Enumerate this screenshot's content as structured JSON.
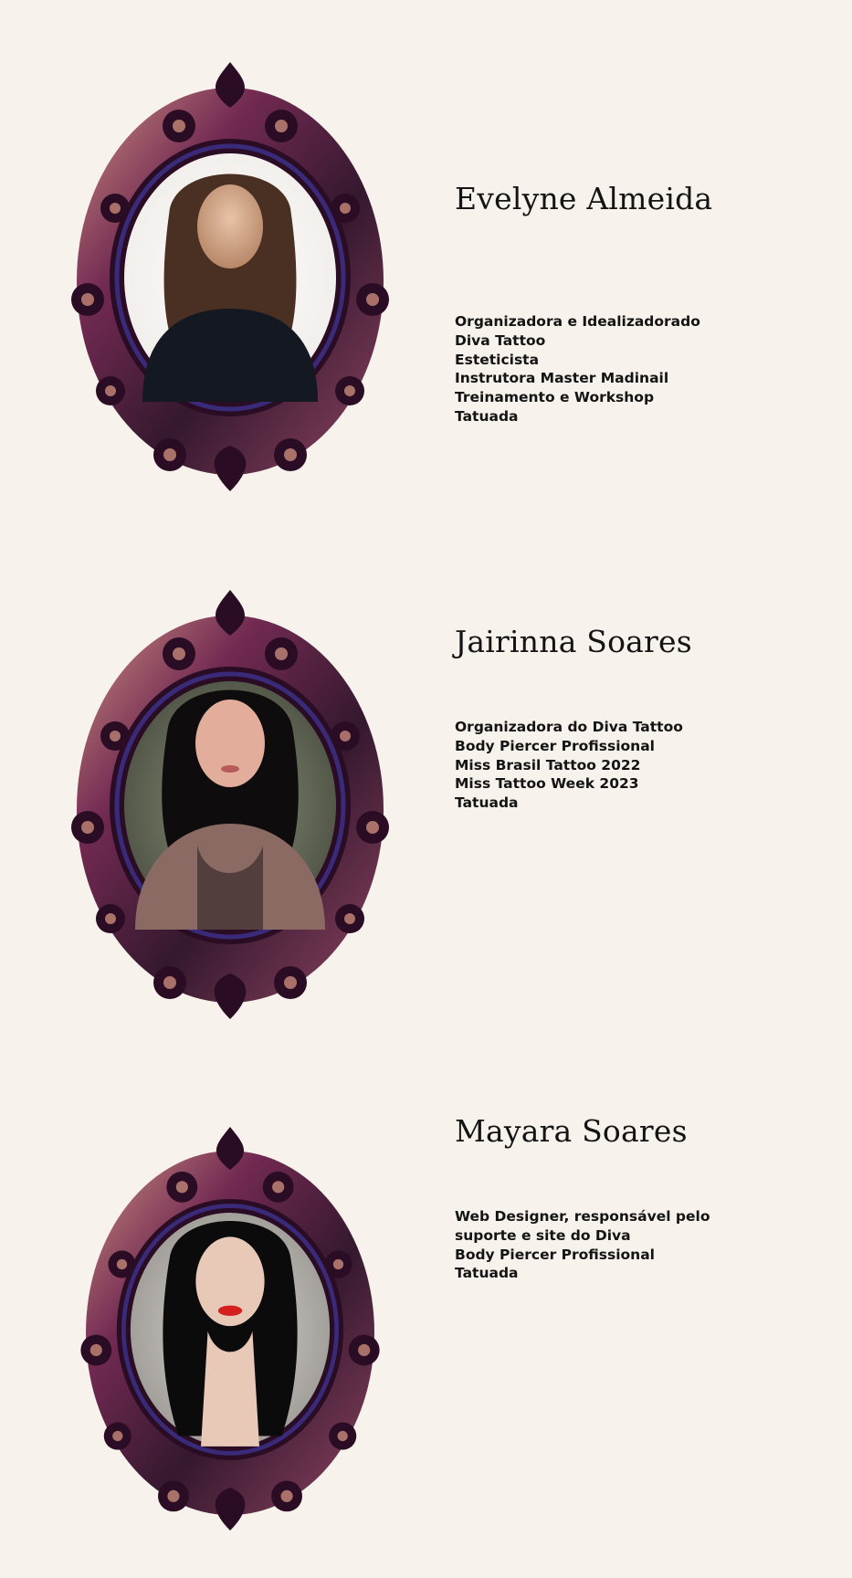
{
  "profiles": [
    {
      "name": "Evelyne Almeida",
      "description_lines": [
        "Organizadora e Idealizadorado Diva Tattoo",
        "Esteticista",
        "Instrutora Master Madinail",
        "Treinamento e Workshop",
        "Tatuada"
      ],
      "photo_icon": "portrait-photo-woman-brown-hair",
      "frame_icon": "ornate-baroque-oval-frame"
    },
    {
      "name": "Jairinna Soares",
      "description_lines": [
        "Organizadora do Diva Tattoo",
        "Body Piercer Profissional",
        "Miss Brasil Tattoo 2022",
        "Miss Tattoo Week 2023",
        "Tatuada"
      ],
      "photo_icon": "portrait-photo-woman-black-hair-tattoos",
      "frame_icon": "ornate-baroque-oval-frame"
    },
    {
      "name": "Mayara Soares",
      "description_lines": [
        "Web Designer, responsável pelo suporte e site do Diva",
        "Body Piercer Profissional",
        "Tatuada"
      ],
      "photo_icon": "portrait-photo-woman-black-hair-red-lips",
      "frame_icon": "ornate-baroque-oval-frame"
    }
  ],
  "colors": {
    "background": "#f7f2ec",
    "text": "#141414",
    "frame_dark": "#2a0d24",
    "frame_mid": "#6b1f4a",
    "frame_highlight": "#c98a7a",
    "frame_inner_ring": "#3a2a7a"
  }
}
